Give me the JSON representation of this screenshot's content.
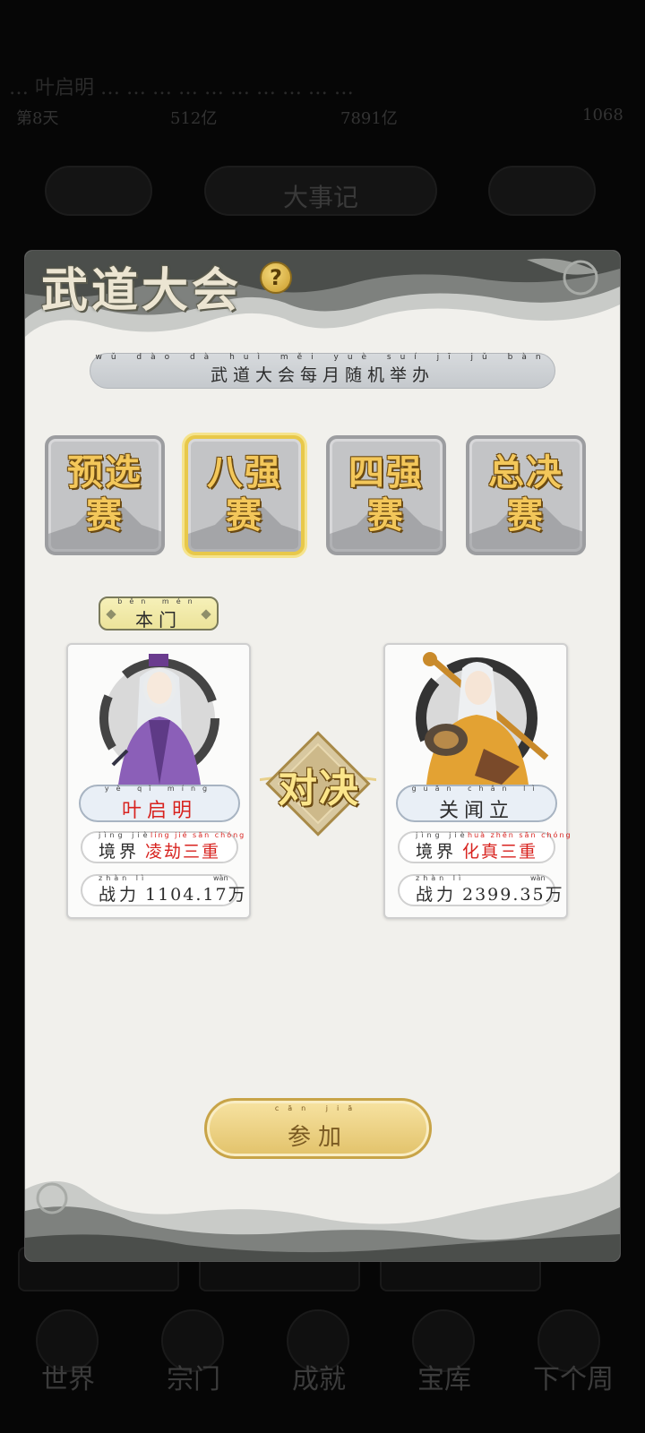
{
  "background": {
    "row1_text": "…  叶启明 …  …  …  …  …  …  …  …  …  …",
    "row2_stats": [
      "第8天",
      "512亿",
      "7891亿",
      "1068"
    ],
    "top_pill_label": "大事记",
    "bottom_buttons": [
      "",
      "",
      "",
      ""
    ],
    "nav": [
      "世界",
      "宗门",
      "成就",
      "宝库",
      "下个周"
    ]
  },
  "dialog": {
    "title": "武道大会",
    "help_icon": "?",
    "notice": "武道大会每月随机举办",
    "notice_pinyin": "wǔ dào dà huì měi yuè suí jī jǔ bàn",
    "stages": [
      {
        "label": "预选赛",
        "active": false
      },
      {
        "label": "八强赛",
        "active": true
      },
      {
        "label": "四强赛",
        "active": false
      },
      {
        "label": "总决赛",
        "active": false
      }
    ],
    "sect_tag": "本门",
    "sect_tag_pinyin": "běn mén",
    "vs_label": "对决",
    "left_player": {
      "name": "叶启明",
      "name_pinyin": "yè qǐ míng",
      "realm_label": "境界",
      "realm_label_pinyin": "jìng jiè",
      "realm_value": "凌劫三重",
      "realm_value_pinyin": "líng jié sān chóng",
      "power_label": "战力",
      "power_label_pinyin": "zhàn lì",
      "power_value": "1104.17万",
      "power_unit_pinyin": "wàn"
    },
    "right_player": {
      "name": "关闻立",
      "name_pinyin": "guān chǎn lì",
      "realm_label": "境界",
      "realm_label_pinyin": "jìng jiè",
      "realm_value": "化真三重",
      "realm_value_pinyin": "huà zhēn sān chóng",
      "power_label": "战力",
      "power_label_pinyin": "zhàn lì",
      "power_value": "2399.35万",
      "power_unit_pinyin": "wàn"
    },
    "join_button": "参加",
    "join_button_pinyin": "cān jiā"
  },
  "colors": {
    "accent_gold": "#f3c75a",
    "realm_red": "#d8231f",
    "panel": "#f1f0ec"
  }
}
